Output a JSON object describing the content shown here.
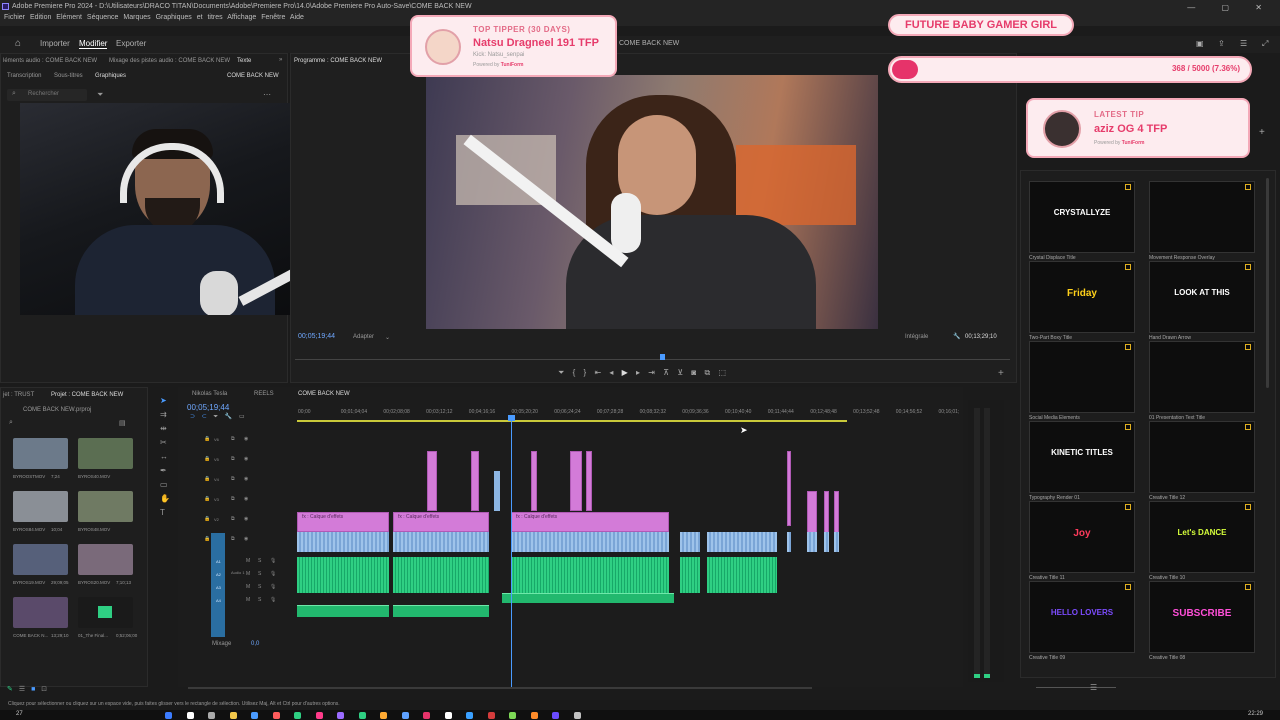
{
  "window": {
    "title": "Adobe Premiere Pro 2024 - D:\\Utilisateurs\\DRACO TITAN\\Documents\\Adobe\\Premiere Pro\\14.0\\Adobe Premiere Pro Auto-Save\\COME BACK NEW",
    "menu": "Fichier  Edition  Elément  Séquence  Marques  Graphiques et titres  Affichage  Fenêtre  Aide",
    "controls": "— ▢ ✕"
  },
  "workspaces": {
    "home_icon": "home-icon",
    "import": "Importer",
    "edit": "Modifier",
    "export": "Exporter"
  },
  "top_panels": {
    "audio_clip_tab": "léments audio : COME BACK NEW",
    "audio_mixer_tab": "Mixage des pistes audio : COME BACK NEW",
    "text_tab": "Texte",
    "sub_tabs": [
      "Transcription",
      "Sous-titres",
      "Graphiques"
    ],
    "sequence_name": "COME BACK NEW",
    "search_placeholder": "Rechercher",
    "program_tab": "Programme : COME BACK NEW",
    "program_seq_label": "COME BACK NEW"
  },
  "program": {
    "timecode": "00;05;19;44",
    "fit": "Adapter",
    "quality": "Intégrale",
    "duration": "00;13;29;10"
  },
  "alerts": {
    "top_tipper": {
      "heading": "TOP TIPPER (30 DAYS)",
      "name": "Natsu Dragneel 191 TFP",
      "sub": "Kick: Natsu_senpai",
      "powered": "Powered by",
      "brand": "TuniForm"
    },
    "goal": {
      "title": "FUTURE BABY GAMER GIRL",
      "progress_text": "368 / 5000 (7.36%)",
      "progress": 0.0736
    },
    "latest_tip": {
      "heading": "LATEST TIP",
      "name": "aziz OG 4 TFP",
      "powered": "Powered by",
      "brand": "TuniForm"
    }
  },
  "project": {
    "tabs": [
      "jet : TRUST",
      "Projet : COME BACK NEW"
    ],
    "file": "COME BACK NEW.prproj",
    "items": [
      {
        "name": "BYROOSTMOV",
        "dur": "7;24"
      },
      {
        "name": "BYROS40.MOV",
        "dur": ""
      },
      {
        "name": "BYROS84.MOV",
        "dur": "10;04"
      },
      {
        "name": "BYROS48.MOV",
        "dur": ""
      },
      {
        "name": "BYROS19.MOV",
        "dur": "29;09;05"
      },
      {
        "name": "BYROS20.MOV",
        "dur": "7;10;13"
      },
      {
        "name": "COME BACK N...",
        "dur": "13;29;10"
      },
      {
        "name": "01_The Final...",
        "dur": "0;52;06;00"
      }
    ]
  },
  "timeline": {
    "tabs": [
      "Nikolas Tesla",
      "REELS",
      "COME BACK NEW"
    ],
    "timecode": "00;05;19;44",
    "ruler": [
      "00;00",
      "00;01;04;04",
      "00;02;08;08",
      "00;03;12;12",
      "00;04;16;16",
      "00;05;20;20",
      "00;06;24;24",
      "00;07;28;28",
      "00;08;32;32",
      "00;09;36;36",
      "00;10;40;40",
      "00;11;44;44",
      "00;12;48;48",
      "00;13;52;48",
      "00;14;56;52",
      "00;16;01;"
    ],
    "video_tracks": [
      "V6",
      "V5",
      "V4",
      "V3",
      "V2",
      "V1"
    ],
    "audio_tracks": [
      "A1",
      "A2",
      "A3",
      "A4"
    ],
    "audio_label": "Audio 1",
    "mix_label": "Mixage",
    "mix_value": "0,0",
    "effect_label": "fx : Calque d'effets"
  },
  "graphics": [
    {
      "title": "Crystal Displace Title",
      "text": "CRYSTALLYZE"
    },
    {
      "title": "Movement Response Overlay",
      "text": ""
    },
    {
      "title": "Two-Part Boxy Title",
      "text": "Friday"
    },
    {
      "title": "Hand Drawn Arrow",
      "text": "LOOK AT THIS"
    },
    {
      "title": "Social Media Elements",
      "text": ""
    },
    {
      "title": "01 Presentation Text Title",
      "text": ""
    },
    {
      "title": "Typography Render 01",
      "text": "KINETIC TITLES"
    },
    {
      "title": "Creative Title 12",
      "text": ""
    },
    {
      "title": "Creative Title 11",
      "text": "Joy"
    },
    {
      "title": "Creative Title 10",
      "text": "Let's DANCE"
    },
    {
      "title": "Creative Title 09",
      "text": "HELLO LOVERS"
    },
    {
      "title": "Creative Title 08",
      "text": "SUBSCRIBE"
    }
  ],
  "status": {
    "hint": "Cliquez pour sélectionner ou cliquez sur un espace vide, puis faites glisser vers le rectangle de sélection. Utilisez Maj, Alt et Ctrl pour d'autres options."
  },
  "taskbar": {
    "temp": "27",
    "time": "22:29"
  },
  "colors": {
    "pink_clip": "#d37bd8",
    "blue_clip": "#8db6e3",
    "green_audio": "#2fcf83",
    "alert_pink": "#fdecef",
    "playhead": "#4a9bff"
  }
}
